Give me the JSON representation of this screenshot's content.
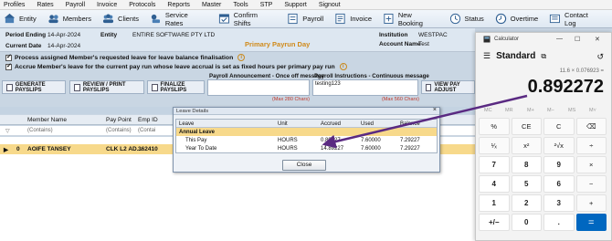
{
  "menu": [
    "Profiles",
    "Rates",
    "Payroll",
    "Invoice",
    "Protocols",
    "Reports",
    "Master",
    "Tools",
    "STP",
    "Support",
    "Signout"
  ],
  "toolbar": [
    {
      "label": "Entity",
      "icon": "entity-icon"
    },
    {
      "label": "Members",
      "icon": "members-icon"
    },
    {
      "label": "Clients",
      "icon": "clients-icon"
    },
    {
      "label": "Service Rates",
      "icon": "service-rates-icon"
    },
    {
      "label": "Confirm Shifts",
      "icon": "confirm-shifts-icon"
    },
    {
      "label": "Payroll",
      "icon": "payroll-icon"
    },
    {
      "label": "Invoice",
      "icon": "invoice-icon"
    },
    {
      "label": "New Booking",
      "icon": "new-booking-icon"
    },
    {
      "label": "Status",
      "icon": "status-icon"
    },
    {
      "label": "Overtime",
      "icon": "overtime-icon"
    },
    {
      "label": "Contact Log",
      "icon": "contact-log-icon"
    }
  ],
  "info": {
    "period_ending_label": "Period Ending",
    "period_ending": "14-Apr-2024",
    "current_date_label": "Current Date",
    "current_date": "14-Apr-2024",
    "entity_label": "Entity",
    "entity": "ENTIRE SOFTWARE PTY LTD",
    "payrun_day": "Primary Payrun Day",
    "institution_label": "Institution",
    "institution": "WESTPAC",
    "account_name_label": "Account Name",
    "account_name": "Test"
  },
  "options": [
    "Process assigned Member's requested leave for leave balance finalisation",
    "Accrue Member's leave for the current pay run whose leave accrual is set as fixed hours per primary pay run"
  ],
  "actions": {
    "generate": "GENERATE PAYSLIPS",
    "review": "REVIEW / PRINT PAYSLIPS",
    "finalize": "FINALIZE PAYSLIPS",
    "view_pay_adjust": "VIEW PAY ADJUST"
  },
  "messages": {
    "announcement_title": "Payroll Announcement - Once off message",
    "announcement_max": "(Max 280 Chars)",
    "instructions_title": "Payroll Instructions - Continuous message",
    "instructions_value": "testing123",
    "instructions_max": "(Max 560 Chars)"
  },
  "grid": {
    "columns": [
      "Member Name",
      "Pay Point",
      "Emp ID"
    ],
    "filter_placeholders": [
      "(Contains)",
      "(Contains)",
      "(Contai"
    ],
    "row": {
      "marker": "▶",
      "num": "0",
      "name": "AOIFE TANSEY",
      "pay_point": "CLK L2 AD...",
      "emp_id": "362410"
    }
  },
  "leave_dialog": {
    "title": "Leave Details",
    "columns": [
      "Leave",
      "Unit",
      "Accrued",
      "Used",
      "Balance"
    ],
    "group": "Annual Leave",
    "rows": [
      {
        "leave": "This Pay",
        "unit": "HOURS",
        "accrued": "0.89227",
        "used": "7.60000",
        "balance": "7.29227"
      },
      {
        "leave": "Year To Date",
        "unit": "HOURS",
        "accrued": "14.89227",
        "used": "7.60000",
        "balance": "7.29227"
      }
    ],
    "close": "Close"
  },
  "calculator": {
    "title": "Calculator",
    "mode": "Standard",
    "expression": "11.6 × 0.076923 =",
    "display": "0.892272",
    "memory": [
      "MC",
      "MR",
      "M+",
      "M−",
      "MS",
      "M˅"
    ],
    "keys": [
      "%",
      "CE",
      "C",
      "⌫",
      "¹⁄ₓ",
      "x²",
      "²√x",
      "÷",
      "7",
      "8",
      "9",
      "×",
      "4",
      "5",
      "6",
      "−",
      "1",
      "2",
      "3",
      "+",
      "+/−",
      "0",
      ".",
      "="
    ]
  },
  "colors": {
    "accent": "#0067c0",
    "highlight_row": "#f7d98b",
    "arrow": "#5a2a82",
    "payrun": "#d08a1a"
  }
}
